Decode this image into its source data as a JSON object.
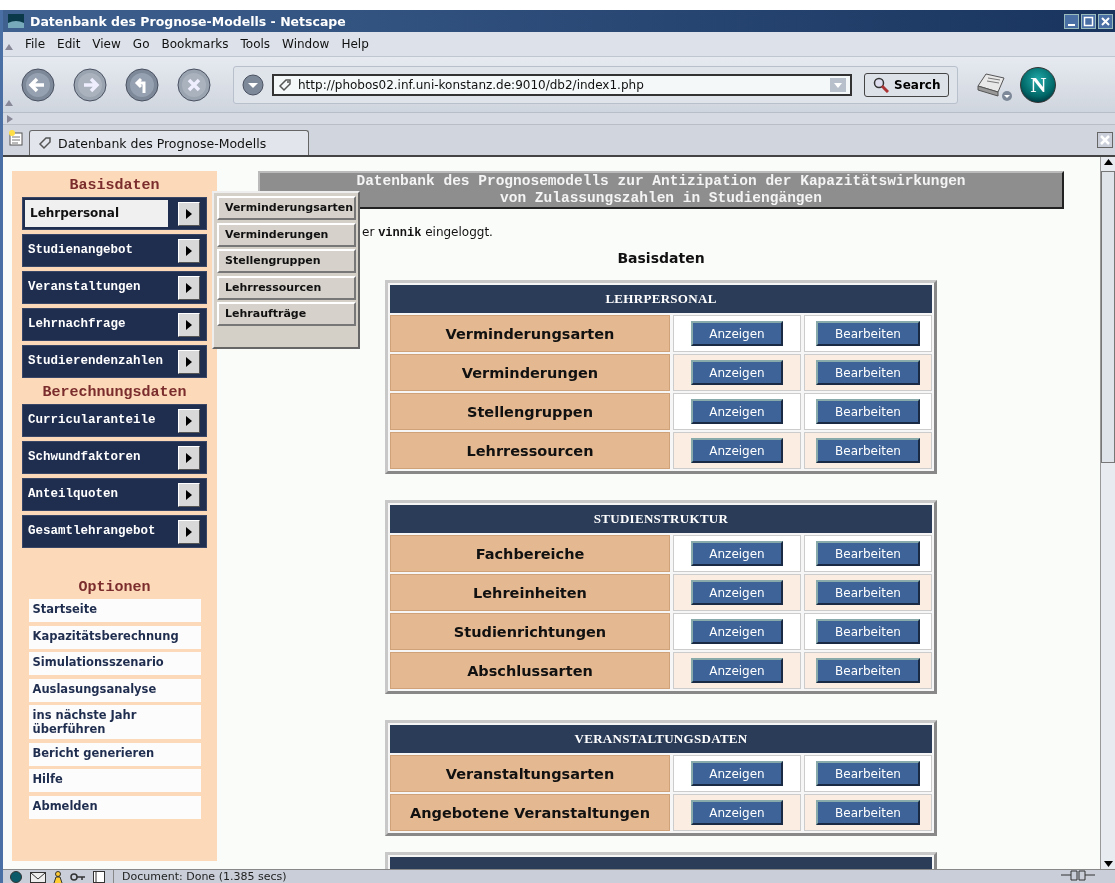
{
  "window": {
    "title": "Datenbank des Prognose-Modells - Netscape"
  },
  "menu": [
    {
      "label": "File"
    },
    {
      "label": "Edit"
    },
    {
      "label": "View"
    },
    {
      "label": "Go"
    },
    {
      "label": "Bookmarks"
    },
    {
      "label": "Tools"
    },
    {
      "label": "Window"
    },
    {
      "label": "Help"
    }
  ],
  "toolbar": {
    "url": "http://phobos02.inf.uni-konstanz.de:9010/db2/index1.php",
    "search_button": "Search",
    "logo": "N"
  },
  "tabs": [
    {
      "label": "Datenbank des Prognose-Modells",
      "selected": true
    }
  ],
  "sidebar": {
    "groups": [
      {
        "heading": "Basisdaten",
        "items": [
          {
            "label": "Lehrpersonal",
            "selected": true
          },
          {
            "label": "Studienangebot",
            "selected": false
          },
          {
            "label": "Veranstaltungen",
            "selected": false
          },
          {
            "label": "Lehrnachfrage",
            "selected": false
          },
          {
            "label": "Studierendenzahlen",
            "selected": false
          }
        ]
      },
      {
        "heading": "Berechnungsdaten",
        "items": [
          {
            "label": "Curricularanteile",
            "selected": false
          },
          {
            "label": "Schwundfaktoren",
            "selected": false
          },
          {
            "label": "Anteilquoten",
            "selected": false
          },
          {
            "label": "Gesamtlehrangebot",
            "selected": false
          }
        ]
      }
    ],
    "options": {
      "heading": "Optionen",
      "items": [
        "Startseite",
        "Kapazitätsberechnung",
        "Simulationsszenario",
        "Auslasungsanalyse",
        "ins nächste Jahr überführen",
        "Bericht generieren",
        "Hilfe",
        "Abmelden"
      ]
    }
  },
  "submenu": {
    "items": [
      "Verminderungsarten",
      "Verminderungen",
      "Stellengruppen",
      "Lehrressourcen",
      "Lehraufträge"
    ]
  },
  "page": {
    "banner": [
      "Datenbank des Prognosemodells zur Antizipation der Kapazitätswirkungen",
      "von Zulassungszahlen in Studiengängen"
    ],
    "login_text": "er **vinnik** eingeloggt.",
    "heading": "Basisdaten",
    "sections": [
      {
        "title": "LEHRPERSONAL",
        "rows": [
          {
            "label": "Verminderungsarten",
            "buttons": [
              "Anzeigen",
              "Bearbeiten"
            ]
          },
          {
            "label": "Verminderungen",
            "buttons": [
              "Anzeigen",
              "Bearbeiten"
            ]
          },
          {
            "label": "Stellengruppen",
            "buttons": [
              "Anzeigen",
              "Bearbeiten"
            ]
          },
          {
            "label": "Lehrressourcen",
            "buttons": [
              "Anzeigen",
              "Bearbeiten"
            ]
          }
        ]
      },
      {
        "title": "STUDIENSTRUKTUR",
        "rows": [
          {
            "label": "Fachbereiche",
            "buttons": [
              "Anzeigen",
              "Bearbeiten"
            ]
          },
          {
            "label": "Lehreinheiten",
            "buttons": [
              "Anzeigen",
              "Bearbeiten"
            ]
          },
          {
            "label": "Studienrichtungen",
            "buttons": [
              "Anzeigen",
              "Bearbeiten"
            ]
          },
          {
            "label": "Abschlussarten",
            "buttons": [
              "Anzeigen",
              "Bearbeiten"
            ]
          }
        ]
      },
      {
        "title": "VERANSTALTUNGSDATEN",
        "rows": [
          {
            "label": "Veranstaltungsarten",
            "buttons": [
              "Anzeigen",
              "Bearbeiten"
            ]
          },
          {
            "label": "Angebotene Veranstaltungen",
            "buttons": [
              "Anzeigen",
              "Bearbeiten"
            ]
          }
        ]
      }
    ],
    "next_section_cut": true
  },
  "status_bar": {
    "text": "Document: Done (1.385 secs)"
  }
}
